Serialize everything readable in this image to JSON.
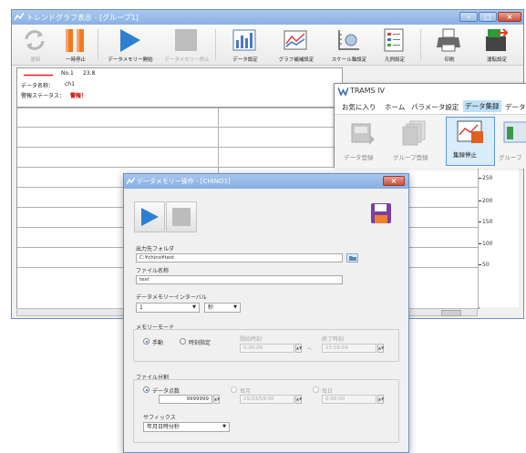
{
  "trend_window": {
    "title": "トレンドグラフ表示 - [グループ1]",
    "toolbar": [
      {
        "id": "refresh",
        "label": "更新",
        "disabled": true
      },
      {
        "id": "pause",
        "label": "一時停止",
        "disabled": false
      },
      {
        "id": "memory-start",
        "label": "データメモリー開始",
        "disabled": false
      },
      {
        "id": "memory-stop",
        "label": "データメモリー停止",
        "disabled": true
      },
      {
        "id": "data-settings",
        "label": "データ設定",
        "disabled": false
      },
      {
        "id": "graph-settings",
        "label": "グラフ補補設定",
        "disabled": false
      },
      {
        "id": "scale-settings",
        "label": "スケール軸設定",
        "disabled": false
      },
      {
        "id": "legend-settings",
        "label": "凡例設定",
        "disabled": false
      },
      {
        "id": "print",
        "label": "印刷",
        "disabled": false
      },
      {
        "id": "operation-settings",
        "label": "運転設定",
        "disabled": false
      }
    ],
    "info": {
      "series_no": "No.1",
      "series_value": "23.8",
      "data_name_label": "データ名称：",
      "data_name_value": "ch1",
      "alarm_label": "警報ステータス：",
      "alarm_value": "警報！"
    },
    "axis_ticks": [
      "250",
      "200",
      "150",
      "100",
      "50"
    ],
    "colors": {
      "series_line": "#e02020",
      "alarm": "#d00000",
      "title_bar": "#8ab1e3"
    }
  },
  "trams": {
    "title": "TRAMS IV",
    "menu": [
      "お気に入り",
      "ホーム",
      "パラメータ設定",
      "データ集録",
      "データ"
    ],
    "active_menu": "データ集録",
    "ribbon": [
      {
        "id": "data-record",
        "label": "データ登録",
        "active": false
      },
      {
        "id": "group-record",
        "label": "グループ登録",
        "active": false
      },
      {
        "id": "collect-stop",
        "label": "集録停止",
        "active": true
      },
      {
        "id": "group-more",
        "label": "グループ",
        "active": false
      }
    ]
  },
  "dialog": {
    "title": "データメモリー操作 - [CHINO1]",
    "output_folder_label": "出力先フォルダ",
    "output_folder_value": "C:¥chino¥test",
    "file_name_label": "ファイル名称",
    "file_name_value": "test",
    "interval_label": "データメモリーインターバル",
    "interval_value": "1",
    "interval_unit": "秒",
    "memory_mode_label": "メモリーモード",
    "mode_manual": "手動",
    "mode_timed": "時刻指定",
    "start_time_label": "開始時刻",
    "start_time_value": "0:00:00",
    "end_time_label": "終了時刻",
    "end_time_value": "23:59:59",
    "file_split_label": "ファイル分割",
    "split_points": "データ点数",
    "split_points_value": "9999999",
    "split_monthly": "毎月",
    "split_monthly_value": "15/23/59:00",
    "split_daily": "毎日",
    "split_daily_value": "0:00:00",
    "suffix_label": "サフィックス",
    "suffix_value": "年月日時分秒",
    "colors": {
      "play": "#2f7fd0",
      "save": "#7a3fa0"
    }
  }
}
